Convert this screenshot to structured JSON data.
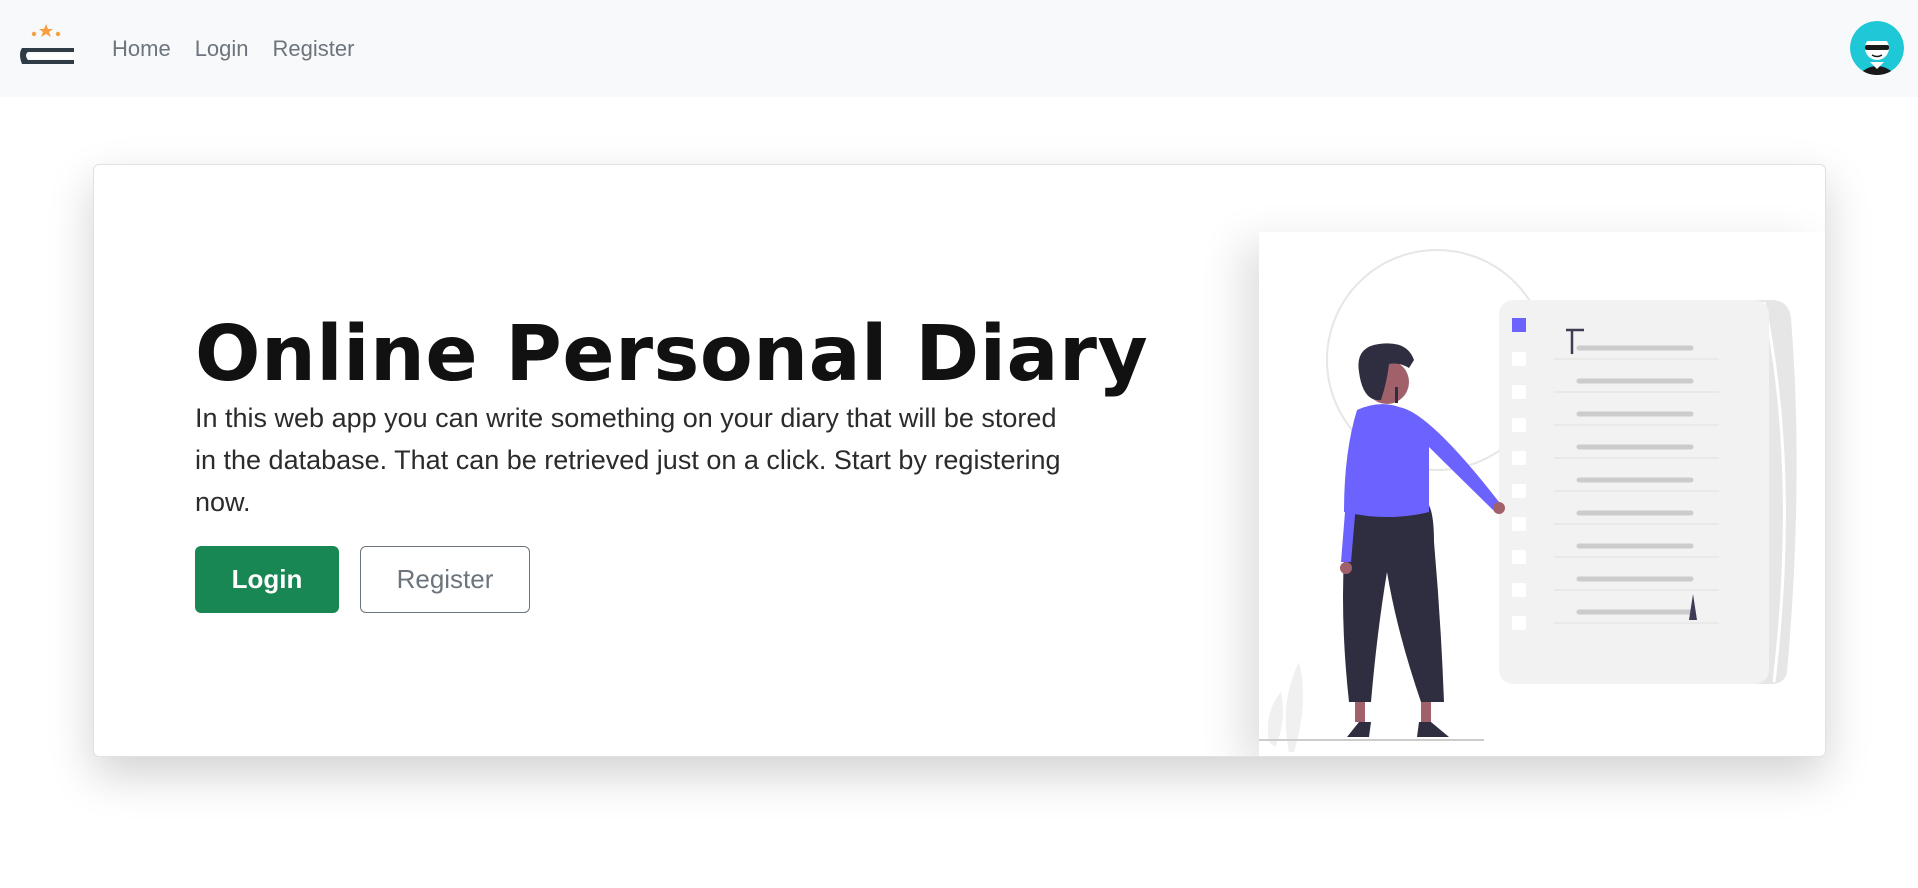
{
  "nav": {
    "brand_icon": "diary-book-icon",
    "links": [
      {
        "label": "Home"
      },
      {
        "label": "Login"
      },
      {
        "label": "Register"
      }
    ],
    "avatar_icon": "user-avatar-icon"
  },
  "hero": {
    "title": "Online Personal Diary",
    "description": "In this web app you can write something on your diary that will be stored in the database. That can be retrieved just on a click. Start by registering now.",
    "login_label": "Login",
    "register_label": "Register",
    "illustration_icon": "woman-with-checklist-illustration"
  },
  "colors": {
    "navbar_bg": "#f8f9fa",
    "primary_green": "#198754",
    "accent_purple": "#6c63ff",
    "avatar_teal": "#1ec8d6"
  }
}
